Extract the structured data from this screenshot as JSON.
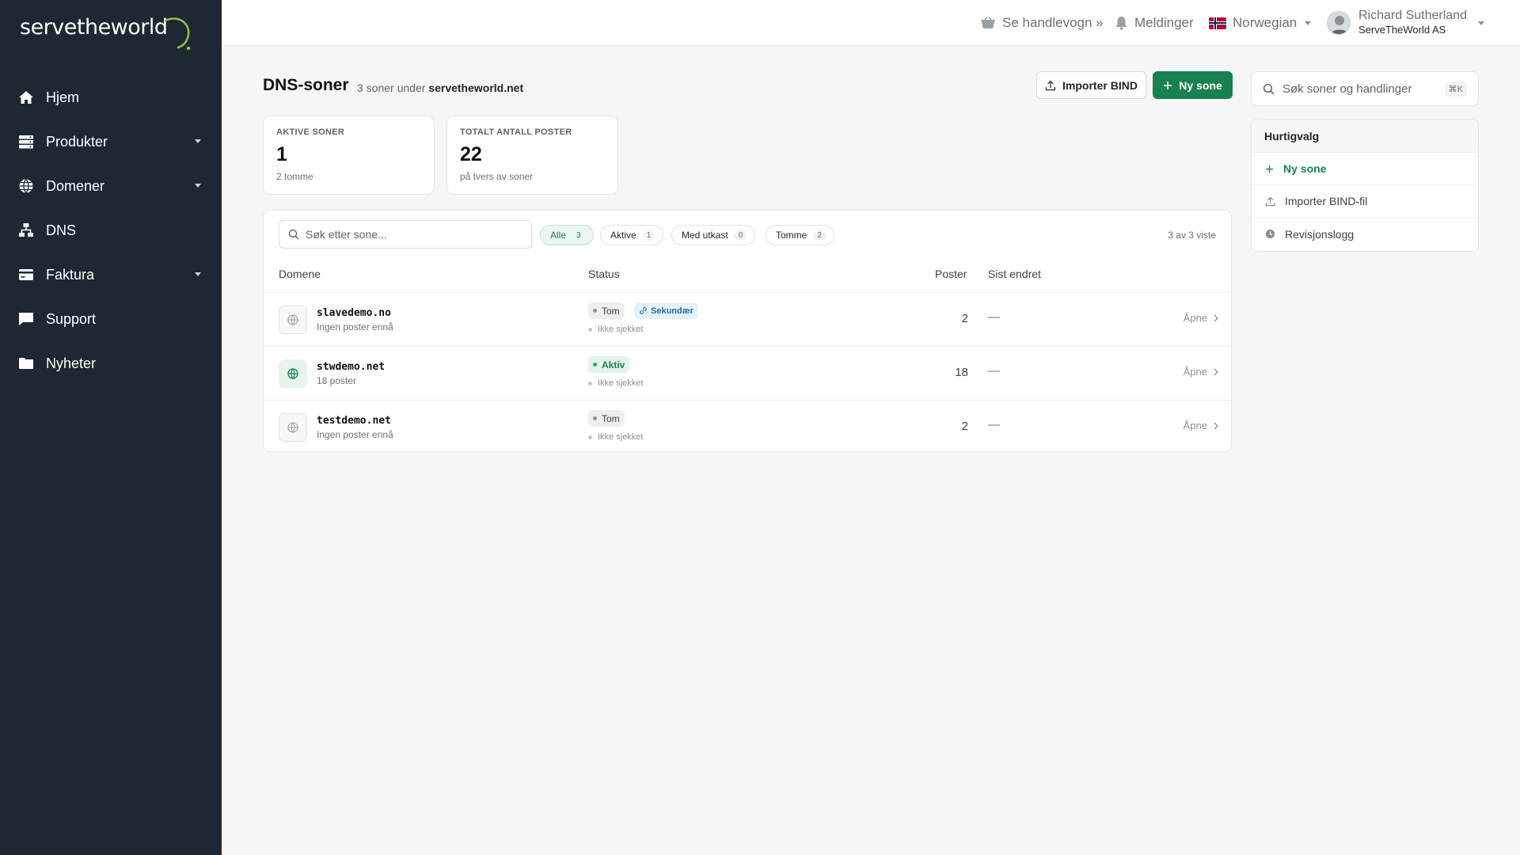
{
  "brand": {
    "logo_text": "servetheworld"
  },
  "sidebar": {
    "items": [
      {
        "label": "Hjem",
        "icon": "home-icon",
        "has_caret": false
      },
      {
        "label": "Produkter",
        "icon": "server-icon",
        "has_caret": true
      },
      {
        "label": "Domener",
        "icon": "globe-icon",
        "has_caret": true
      },
      {
        "label": "DNS",
        "icon": "sitemap-icon",
        "has_caret": false
      },
      {
        "label": "Faktura",
        "icon": "credit-card-icon",
        "has_caret": true
      },
      {
        "label": "Support",
        "icon": "chat-icon",
        "has_caret": false
      },
      {
        "label": "Nyheter",
        "icon": "folder-icon",
        "has_caret": false
      }
    ]
  },
  "topbar": {
    "cart_label": "Se handlevogn »",
    "notifications_label": "Meldinger",
    "language_label": "Norwegian",
    "user_name": "Richard Sutherland",
    "user_company": "ServeTheWorld AS"
  },
  "page": {
    "title": "DNS-soner",
    "subtitle_prefix": "3 soner under",
    "subtitle_domain": "servetheworld.net",
    "import_button": "Importer BIND",
    "new_button": "Ny sone"
  },
  "stats": [
    {
      "label": "AKTIVE SONER",
      "value": "1",
      "note": "2 tomme"
    },
    {
      "label": "TOTALT ANTALL POSTER",
      "value": "22",
      "note": "på tvers av soner"
    }
  ],
  "table": {
    "search_placeholder": "Søk etter sone...",
    "filters": [
      {
        "label": "Alle",
        "count": "3",
        "active": true
      },
      {
        "label": "Aktive",
        "count": "1",
        "active": false
      },
      {
        "label": "Med utkast",
        "count": "0",
        "active": false
      },
      {
        "label": "Tomme",
        "count": "2",
        "active": false
      }
    ],
    "shown_text": "3 av 3 viste",
    "headers": {
      "domain": "Domene",
      "status": "Status",
      "records": "Poster",
      "changed": "Sist endret"
    },
    "rows": [
      {
        "domain": "slavedemo.no",
        "sub": "Ingen poster ennå",
        "status": "Tom",
        "extra_badge": "Sekundær",
        "check": "Ikke sjekket",
        "records": "2",
        "changed": "—",
        "open": "Åpne"
      },
      {
        "domain": "stwdemo.net",
        "sub": "18 poster",
        "status": "Aktiv",
        "extra_badge": "",
        "check": "Ikke sjekket",
        "records": "18",
        "changed": "—",
        "open": "Åpne"
      },
      {
        "domain": "testdemo.net",
        "sub": "Ingen poster ennå",
        "status": "Tom",
        "extra_badge": "",
        "check": "Ikke sjekket",
        "records": "2",
        "changed": "—",
        "open": "Åpne"
      }
    ]
  },
  "right_panel": {
    "search_placeholder": "Søk soner og handlinger",
    "shortcut": "⌘K",
    "quick_title": "Hurtigvalg",
    "quick_items": [
      {
        "label": "Ny sone",
        "icon": "plus-icon"
      },
      {
        "label": "Importer BIND-fil",
        "icon": "upload-icon"
      },
      {
        "label": "Revisjonslogg",
        "icon": "clock-icon"
      }
    ]
  },
  "colors": {
    "sidebar_bg": "#1d2833",
    "accent_green": "#17824f",
    "logo_swoosh": "#8dc63f"
  }
}
